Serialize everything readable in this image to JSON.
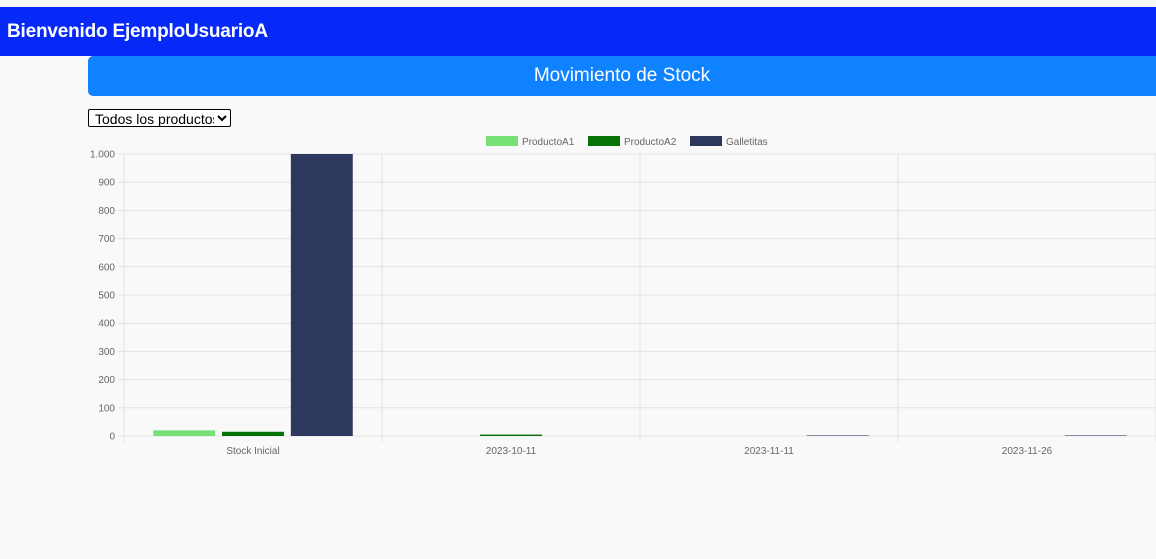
{
  "header": {
    "welcome": "Bienvenido EjemploUsuarioA"
  },
  "section": {
    "title": "Movimiento de Stock"
  },
  "filter": {
    "selected": "Todos los productos",
    "options": [
      "Todos los productos"
    ]
  },
  "colors": {
    "topbar": "#0629f7",
    "section_header": "#0f82ff"
  },
  "chart_data": {
    "type": "bar",
    "categories": [
      "Stock Inicial",
      "2023-10-11",
      "2023-11-11",
      "2023-11-26"
    ],
    "series": [
      {
        "name": "ProductoA1",
        "color": "#77e077",
        "values": [
          20,
          0,
          0,
          0
        ]
      },
      {
        "name": "ProductoA2",
        "color": "#057305",
        "values": [
          15,
          5,
          0,
          0
        ]
      },
      {
        "name": "Galletitas",
        "color": "#2e385e",
        "values": [
          1000,
          0,
          2,
          2
        ]
      }
    ],
    "yticks": [
      "0",
      "100",
      "200",
      "300",
      "400",
      "500",
      "600",
      "700",
      "800",
      "900",
      "1.000"
    ],
    "ylim": [
      0,
      1000
    ],
    "grid": true,
    "legend": "top-center"
  }
}
